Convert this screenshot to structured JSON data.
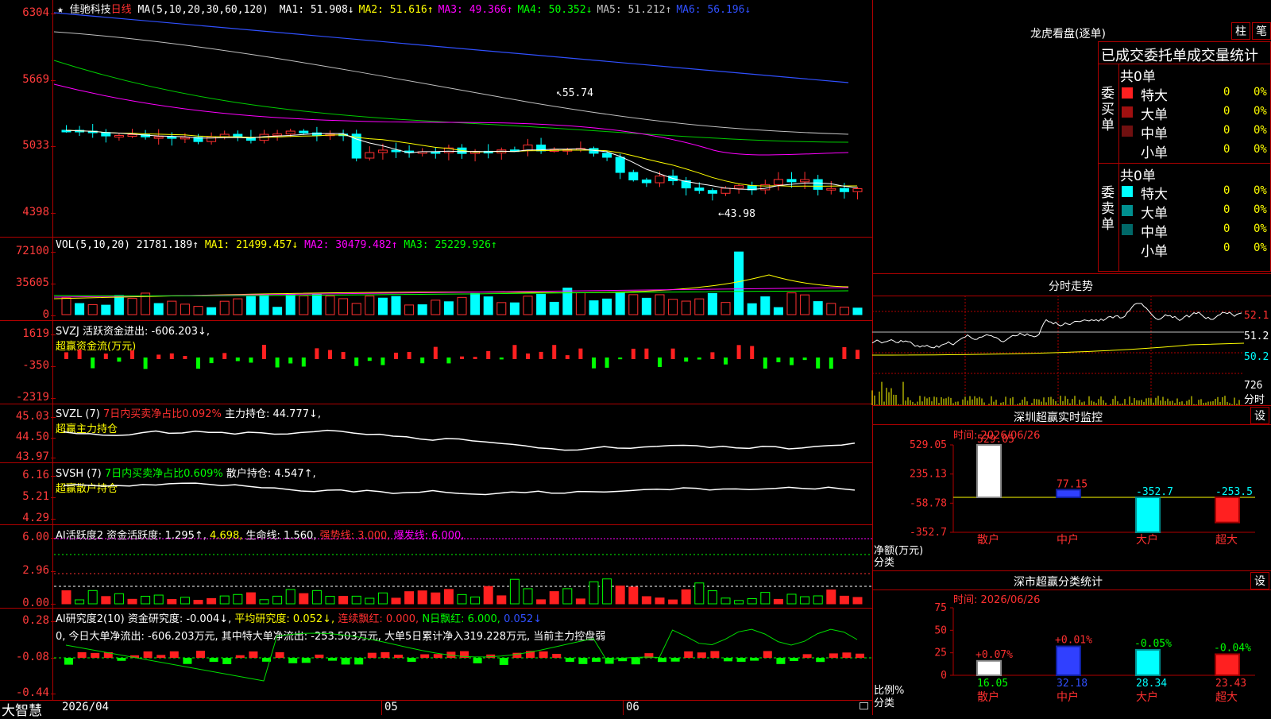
{
  "main": {
    "star": "★",
    "stock_name": "佳驰科技",
    "period": "日线",
    "ma_label": "MA(5,10,20,30,60,120)",
    "ma": [
      {
        "label": "MA1:",
        "value": "51.908↓",
        "color": "#ffffff"
      },
      {
        "label": "MA2:",
        "value": "51.616↑",
        "color": "#ffff00"
      },
      {
        "label": "MA3:",
        "value": "49.366↑",
        "color": "#ff00ff"
      },
      {
        "label": "MA4:",
        "value": "50.352↓",
        "color": "#00ff00"
      },
      {
        "label": "MA5:",
        "value": "51.212↑",
        "color": "#c0c0c0"
      },
      {
        "label": "MA6:",
        "value": "56.196↓",
        "color": "#3050ff"
      }
    ],
    "y_ticks": [
      "6304",
      "5669",
      "5033",
      "4398"
    ],
    "high_mark": "55.74",
    "low_mark": "43.98"
  },
  "vol": {
    "label": "VOL(5,10,20)",
    "value": "21781.189↑",
    "ma1": "MA1: 21499.457↓",
    "ma2": "MA2: 30479.482↑",
    "ma3": "MA3: 25229.926↑",
    "y_ticks": [
      "72100",
      "35605",
      "0"
    ]
  },
  "svzj": {
    "line1": "SVZJ  活跃资金进出: -606.203↓,",
    "line2": "超赢资金流(万元)",
    "y_ticks": [
      "1619",
      "-350",
      "-2319"
    ]
  },
  "svzl": {
    "name": "SVZL (7)",
    "pct": "7日内买卖净占比0.092%",
    "hold": "主力持仓: 44.777↓,",
    "line2": "超赢主力持仓",
    "y_ticks": [
      "45.03",
      "44.50",
      "43.97"
    ]
  },
  "svsh": {
    "name": "SVSH (7)",
    "pct": "7日内买卖净占比0.609%",
    "hold": "散户持仓: 4.547↑,",
    "line2": "超赢散户持仓",
    "y_ticks": [
      "6.16",
      "5.21",
      "4.29"
    ]
  },
  "ai1": {
    "name": "AI活跃度2",
    "t1": "资金活跃度: 1.295↑,",
    "t2": "4.698,",
    "t3": "生命线: 1.560,",
    "t4": "强势线: 3.000,",
    "t5": "爆发线: 6.000,",
    "y_ticks": [
      "6.00",
      "2.96",
      "0.00"
    ]
  },
  "ai2": {
    "name": "AI研究度2(10)",
    "t1": "资金研究度: -0.004↓,",
    "t2": "平均研究度: 0.052↓,",
    "t3": "连续飘红: 0.000,",
    "t4": "N日飘红: 6.000,",
    "t5": "0.052↓",
    "line2": "0, 今日大单净流出: -606.203万元, 其中特大单净流出: -253.503万元, 大单5日累计净入319.228万元, 当前主力控盘弱",
    "y_ticks": [
      "0.28",
      "-0.08",
      "-0.44"
    ]
  },
  "footer": {
    "brand": "大智慧",
    "dates": [
      "2026/04",
      "05",
      "06"
    ]
  },
  "lhkp": {
    "title": "龙虎看盘(逐单)",
    "btn1": "柱",
    "btn2": "笔",
    "header": "已成交委托单成交量统计",
    "buy": {
      "side": "委买单",
      "total": "共0单",
      "rows": [
        {
          "name": "特大",
          "n": "0",
          "p": "0%",
          "color": "#ff2020"
        },
        {
          "name": "大单",
          "n": "0",
          "p": "0%",
          "color": "#a01010"
        },
        {
          "name": "中单",
          "n": "0",
          "p": "0%",
          "color": "#701010"
        },
        {
          "name": "小单",
          "n": "0",
          "p": "0%",
          "color": ""
        }
      ]
    },
    "sell": {
      "side": "委卖单",
      "total": "共0单",
      "rows": [
        {
          "name": "特大",
          "n": "0",
          "p": "0%",
          "color": "#00ffff"
        },
        {
          "name": "大单",
          "n": "0",
          "p": "0%",
          "color": "#009090"
        },
        {
          "name": "中单",
          "n": "0",
          "p": "0%",
          "color": "#006868"
        },
        {
          "name": "小单",
          "n": "0",
          "p": "0%",
          "color": ""
        }
      ]
    }
  },
  "fenshi": {
    "title": "分时走势",
    "prices": [
      "52.1",
      "51.2",
      "50.2"
    ],
    "vol": "726",
    "unit": "分时"
  },
  "monitor": {
    "title": "深圳超赢实时监控",
    "btn": "设",
    "time": "时间: 2026/06/26",
    "y_ticks": [
      "529.05",
      "235.13",
      "-58.78",
      "-352.7"
    ],
    "axis_label": "净额(万元)",
    "cat_label": "分类",
    "bars": [
      {
        "cat": "散户",
        "value": "529.05"
      },
      {
        "cat": "中户",
        "value": "77.15"
      },
      {
        "cat": "大户",
        "value": "-352.7"
      },
      {
        "cat": "超大",
        "value": "-253.5"
      }
    ]
  },
  "classify": {
    "title": "深市超赢分类统计",
    "btn": "设",
    "time": "时间: 2026/06/26",
    "y_ticks": [
      "75",
      "50",
      "25",
      "0"
    ],
    "axis_label": "比例%",
    "cat_label": "分类",
    "bars": [
      {
        "cat": "散户",
        "value": "16.05",
        "delta": "+0.07%"
      },
      {
        "cat": "中户",
        "value": "32.18",
        "delta": "+0.01%"
      },
      {
        "cat": "大户",
        "value": "28.34",
        "delta": "-0.05%"
      },
      {
        "cat": "超大",
        "value": "23.43",
        "delta": "-0.04%"
      }
    ]
  },
  "chart_data": [
    {
      "type": "bar",
      "title": "深圳超赢实时监控",
      "ylabel": "净额(万元)",
      "categories": [
        "散户",
        "中户",
        "大户",
        "超大"
      ],
      "values": [
        529.05,
        77.15,
        -352.7,
        -253.5
      ],
      "ylim": [
        -352.7,
        529.05
      ]
    },
    {
      "type": "bar",
      "title": "深市超赢分类统计",
      "ylabel": "比例%",
      "categories": [
        "散户",
        "中户",
        "大户",
        "超大"
      ],
      "values": [
        16.05,
        32.18,
        28.34,
        23.43
      ],
      "ylim": [
        0,
        75
      ]
    }
  ]
}
